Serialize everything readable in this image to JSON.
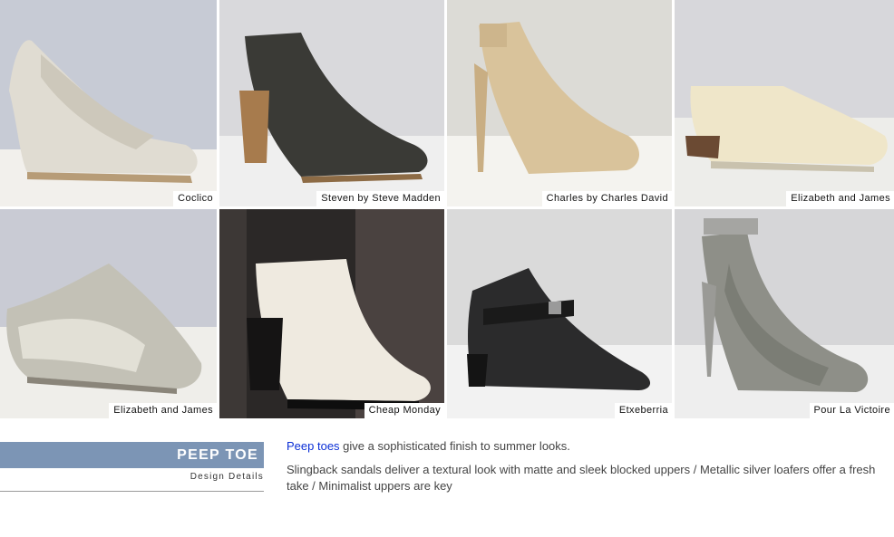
{
  "gallery": {
    "tiles": [
      {
        "caption": "Coclico"
      },
      {
        "caption": "Steven by Steve Madden"
      },
      {
        "caption": "Charles by Charles David"
      },
      {
        "caption": "Elizabeth and James"
      },
      {
        "caption": "Elizabeth and James"
      },
      {
        "caption": "Cheap Monday"
      },
      {
        "caption": "Etxeberria"
      },
      {
        "caption": "Pour La Victoire"
      }
    ]
  },
  "section": {
    "title": "PEEP TOE",
    "subtitle": "Design Details"
  },
  "body": {
    "link_text": "Peep toes",
    "line1_rest": " give a sophisticated finish to summer looks.",
    "paragraph2": "Slingback sandals deliver a textural look with matte and sleek blocked uppers / Metallic silver loafers offer a fresh take / Minimalist uppers are key"
  },
  "colors": {
    "band": "#7c95b5",
    "link": "#0b2fd6"
  }
}
